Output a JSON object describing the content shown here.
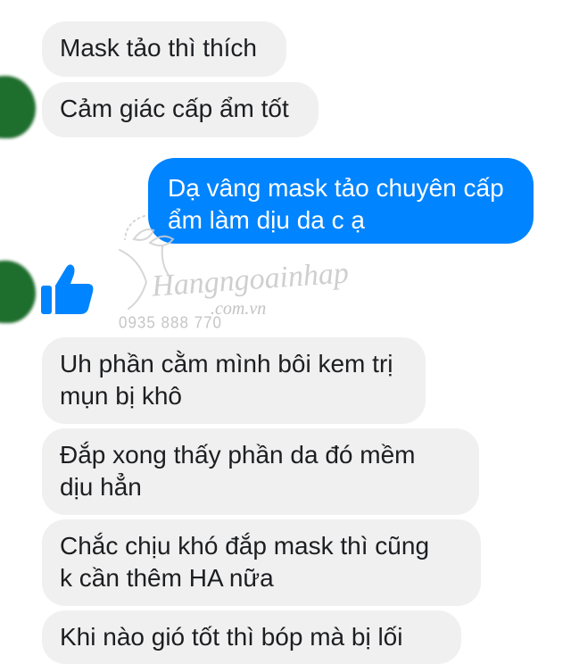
{
  "messages": {
    "m1": {
      "lines": [
        "Mask tảo thì thích"
      ]
    },
    "m2": {
      "lines": [
        "Cảm giác cấp ẩm tốt"
      ]
    },
    "m3": {
      "lines": [
        "Dạ vâng mask tảo chuyên cấp",
        "ẩm làm dịu da  c ạ"
      ]
    },
    "m4": {
      "lines": [
        "Uh phần cằm mình bôi kem trị",
        "mụn bị khô"
      ]
    },
    "m5": {
      "lines": [
        "Đắp xong thấy phần da đó mềm",
        "dịu hẳn"
      ]
    },
    "m6": {
      "lines": [
        "Chắc chịu khó đắp mask thì cũng",
        "k cần thêm HA nữa"
      ]
    },
    "m7": {
      "lines": [
        "Khi nào gió tốt thì bóp mà bị lối"
      ]
    }
  },
  "watermark": {
    "brand": "Hangngoainhap",
    "domain": ".com.vn",
    "phone": "0935 888 770"
  },
  "colors": {
    "incoming_bubble": "#f1f0f0",
    "outgoing_bubble": "#0084ff",
    "like_icon": "#0084ff"
  },
  "icons": {
    "like": "thumbs-up-icon",
    "avatar": "contact-avatar"
  }
}
